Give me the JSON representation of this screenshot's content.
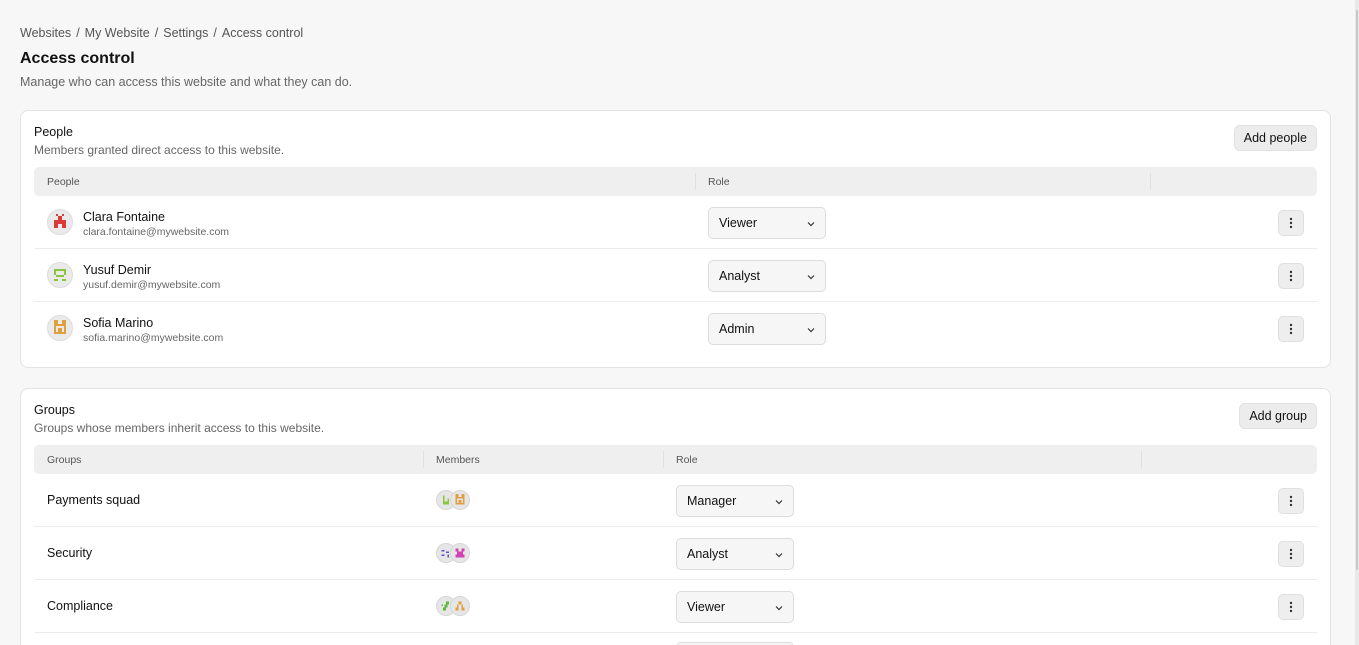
{
  "breadcrumb": {
    "items": [
      "Websites",
      "My Website",
      "Settings",
      "Access control"
    ],
    "separator": "/"
  },
  "page": {
    "title": "Access control",
    "description": "Manage who can access this website and what they can do."
  },
  "people": {
    "title": "People",
    "subtitle": "Members granted direct access to this website.",
    "add_button": "Add people",
    "columns": [
      "People",
      "Role"
    ],
    "rows": [
      {
        "name": "Clara Fontaine",
        "email": "clara.fontaine@mywebsite.com",
        "role": "Viewer",
        "avatar_color": "#d93a3a"
      },
      {
        "name": "Yusuf Demir",
        "email": "yusuf.demir@mywebsite.com",
        "role": "Analyst",
        "avatar_color": "#8bc53f"
      },
      {
        "name": "Sofia Marino",
        "email": "sofia.marino@mywebsite.com",
        "role": "Admin",
        "avatar_color": "#e0a040"
      }
    ]
  },
  "groups": {
    "title": "Groups",
    "subtitle": "Groups whose members inherit access to this website.",
    "add_button": "Add group",
    "columns": [
      "Groups",
      "Members",
      "Role"
    ],
    "rows": [
      {
        "name": "Payments squad",
        "role": "Manager",
        "member_colors": [
          "#8bc53f",
          "#e0a040"
        ]
      },
      {
        "name": "Security",
        "role": "Analyst",
        "member_colors": [
          "#6a4fc4",
          "#d640b5"
        ]
      },
      {
        "name": "Compliance",
        "role": "Viewer",
        "member_colors": [
          "#5ab83e",
          "#e0a040"
        ]
      }
    ]
  },
  "icons": {
    "select_chevron": "chevron-down-icon",
    "row_menu": "kebab-menu-icon",
    "avatar": "pixel-avatar-icon"
  }
}
